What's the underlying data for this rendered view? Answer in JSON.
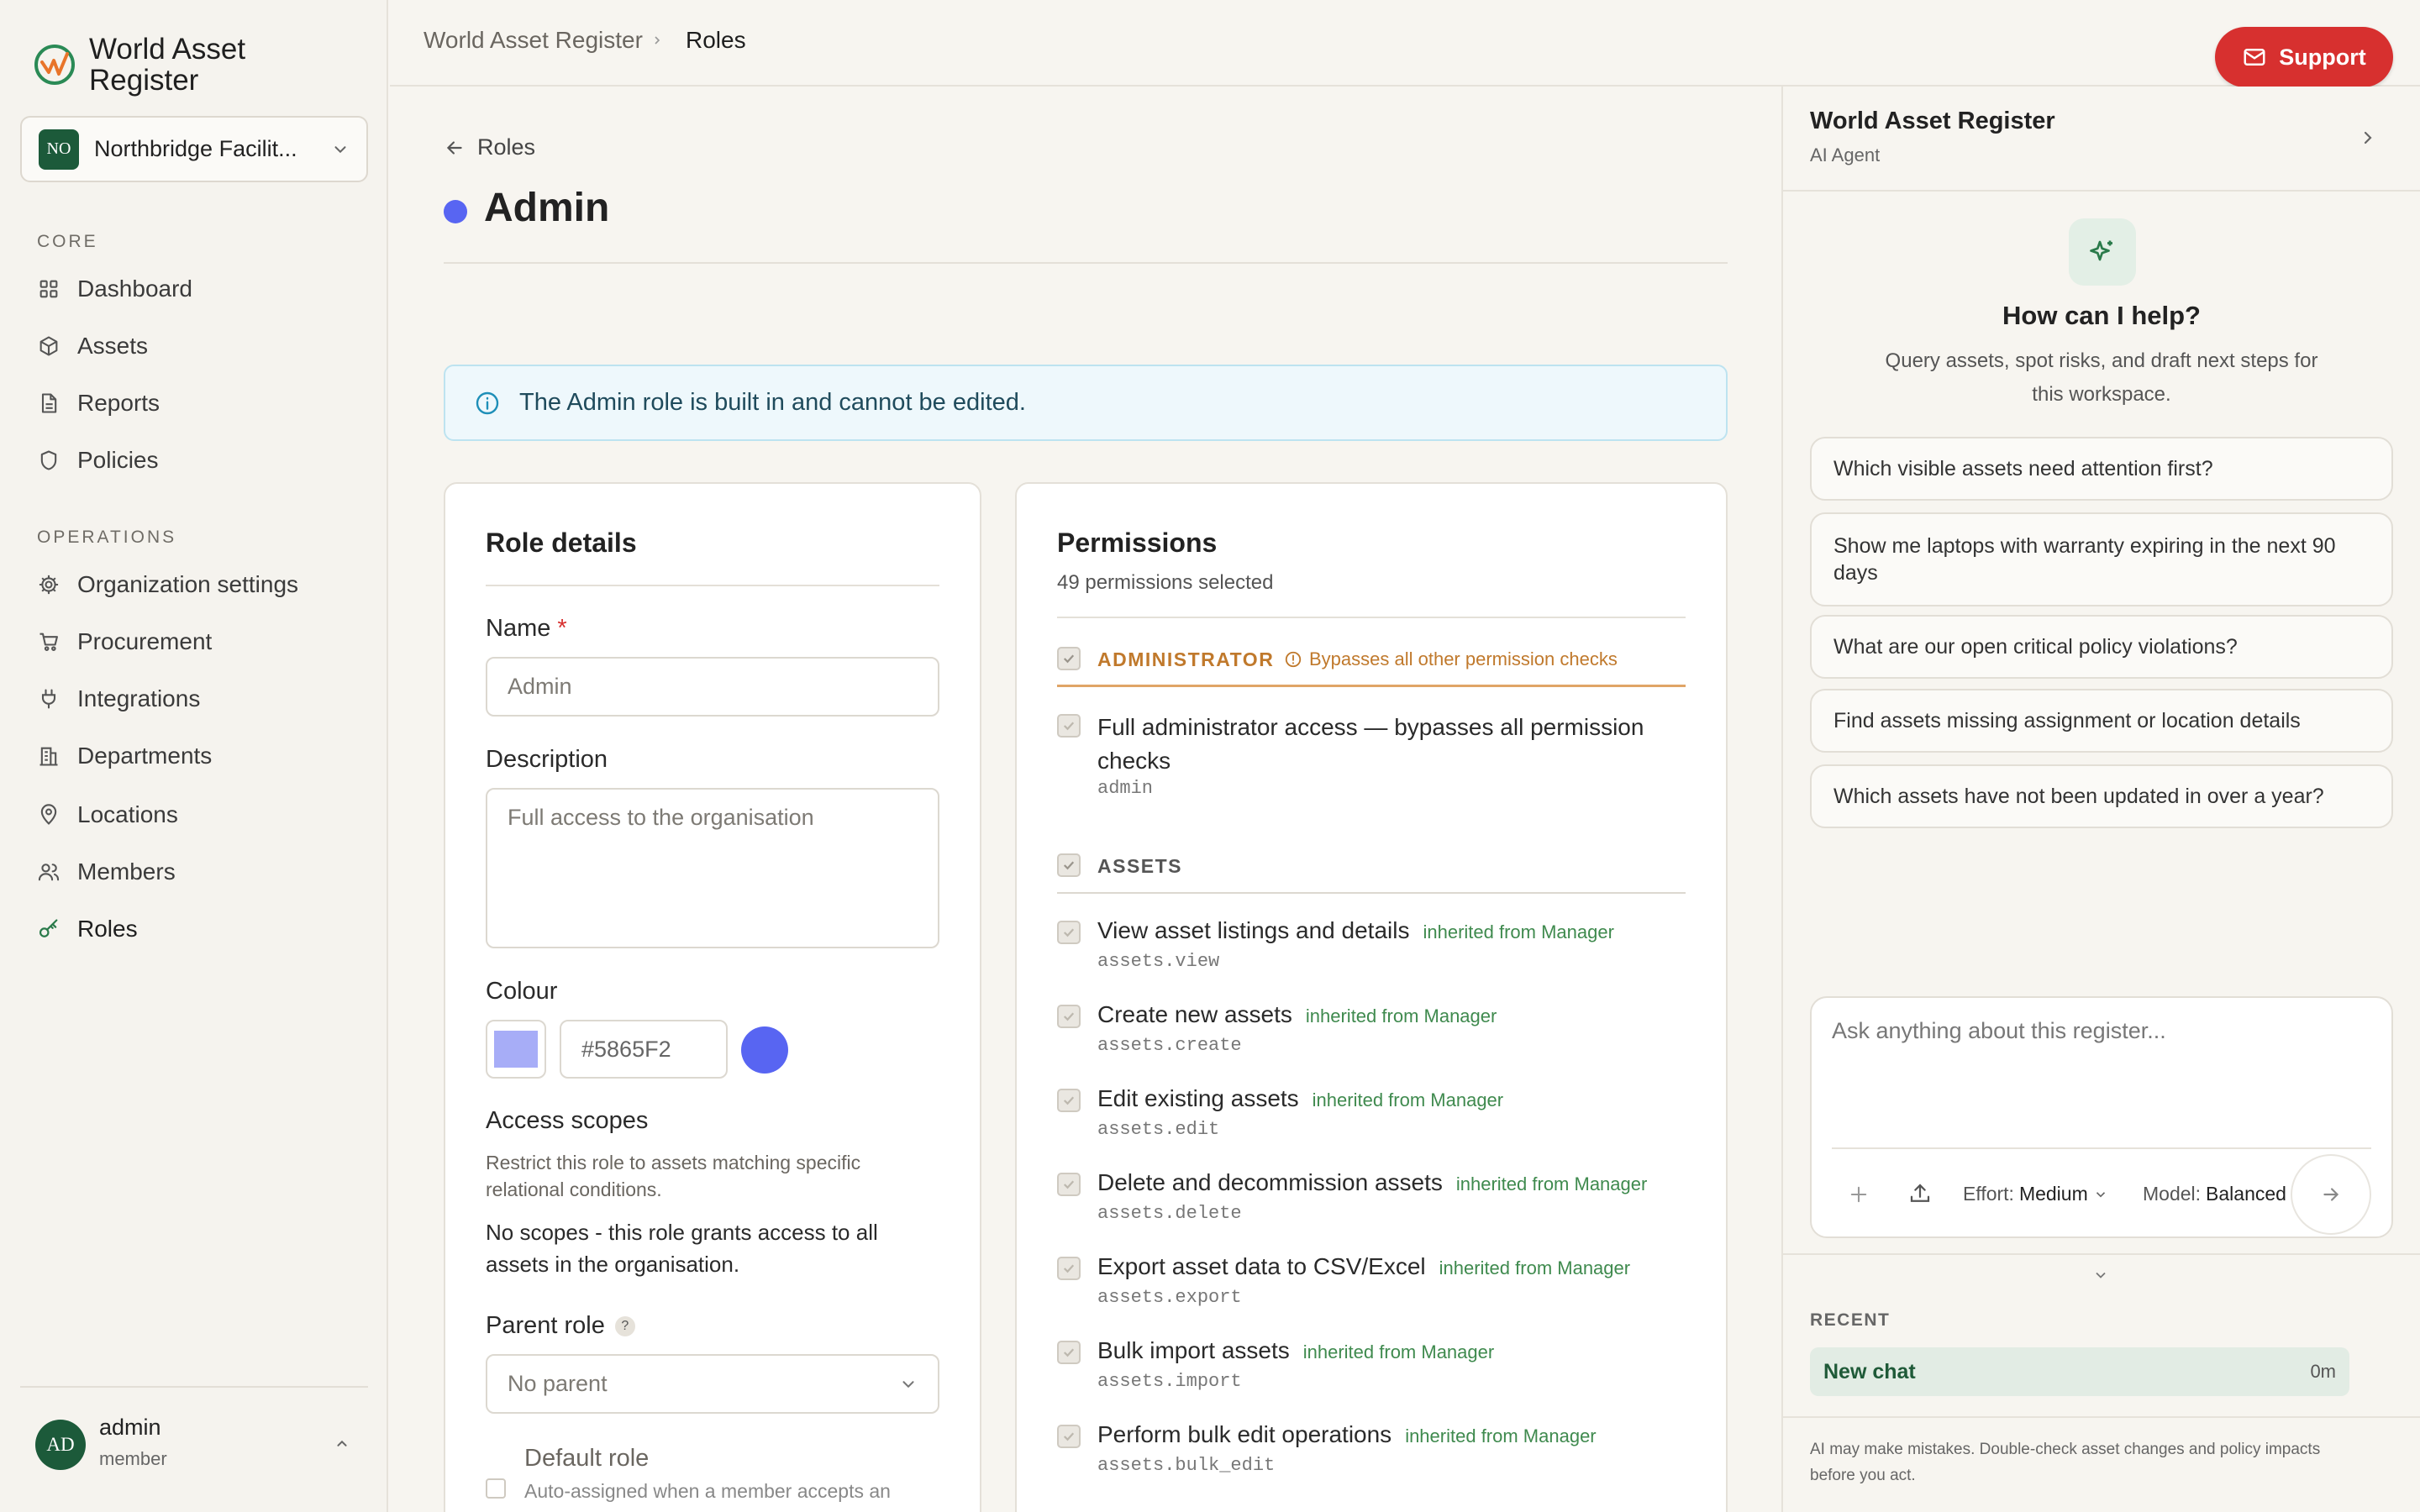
{
  "app": {
    "title": "World Asset Register"
  },
  "org": {
    "badge": "NO",
    "name": "Northbridge Facilit..."
  },
  "sidebar": {
    "core_heading": "CORE",
    "ops_heading": "OPERATIONS",
    "core_items": [
      {
        "label": "Dashboard",
        "icon": "grid-icon"
      },
      {
        "label": "Assets",
        "icon": "box-icon"
      },
      {
        "label": "Reports",
        "icon": "document-icon"
      },
      {
        "label": "Policies",
        "icon": "shield-icon"
      }
    ],
    "ops_items": [
      {
        "label": "Organization settings",
        "icon": "gear-icon"
      },
      {
        "label": "Procurement",
        "icon": "cart-icon"
      },
      {
        "label": "Integrations",
        "icon": "plug-icon"
      },
      {
        "label": "Departments",
        "icon": "building-icon"
      },
      {
        "label": "Locations",
        "icon": "pin-icon"
      },
      {
        "label": "Members",
        "icon": "users-icon"
      },
      {
        "label": "Roles",
        "icon": "key-icon",
        "active": true
      }
    ]
  },
  "user": {
    "initials": "AD",
    "name": "admin",
    "role": "member"
  },
  "breadcrumb": {
    "root": "World Asset Register",
    "current": "Roles"
  },
  "support": {
    "label": "Support"
  },
  "page": {
    "back_label": "Roles",
    "title": "Admin",
    "role_color": "#5865F2",
    "notice": "The Admin role is built in and cannot be edited."
  },
  "role_details": {
    "heading": "Role details",
    "name_label": "Name",
    "required_mark": "*",
    "name_placeholder": "Admin",
    "description_label": "Description",
    "description_placeholder": "Full access to the organisation",
    "colour_label": "Colour",
    "colour_value": "#5865F2",
    "access_scopes_label": "Access scopes",
    "access_scopes_hint": "Restrict this role to assets matching specific relational conditions.",
    "access_scopes_text": "No scopes - this role grants access to all assets in the organisation.",
    "parent_role_label": "Parent role",
    "parent_role_help": "?",
    "parent_role_value": "No parent",
    "default_role_label": "Default role",
    "default_role_hint": "Auto-assigned when a member accepts an"
  },
  "permissions": {
    "heading": "Permissions",
    "count_text": "49 permissions selected",
    "admin_group": {
      "label": "ADMINISTRATOR",
      "note": "Bypasses all other permission checks",
      "item_label_1": "Full administrator access — bypasses all permission",
      "item_label_2": "checks",
      "item_code": "admin"
    },
    "assets_group": {
      "label": "ASSETS"
    },
    "items": [
      {
        "label": "View asset listings and details",
        "inherited": "inherited from Manager",
        "code": "assets.view"
      },
      {
        "label": "Create new assets",
        "inherited": "inherited from Manager",
        "code": "assets.create"
      },
      {
        "label": "Edit existing assets",
        "inherited": "inherited from Manager",
        "code": "assets.edit"
      },
      {
        "label": "Delete and decommission assets",
        "inherited": "inherited from Manager",
        "code": "assets.delete"
      },
      {
        "label": "Export asset data to CSV/Excel",
        "inherited": "inherited from Manager",
        "code": "assets.export"
      },
      {
        "label": "Bulk import assets",
        "inherited": "inherited from Manager",
        "code": "assets.import"
      },
      {
        "label": "Perform bulk edit operations",
        "inherited": "inherited from Manager",
        "code": "assets.bulk_edit"
      }
    ]
  },
  "agent": {
    "title": "World Asset Register",
    "subtitle": "AI Agent",
    "help_title": "How can I help?",
    "help_text_1": "Query assets, spot risks, and draft next steps for",
    "help_text_2": "this workspace.",
    "suggestions": [
      "Which visible assets need attention first?",
      "Show me laptops with warranty expiring in the next 90 days",
      "What are our open critical policy violations?",
      "Find assets missing assignment or location details",
      "Which assets have not been updated in over a year?"
    ],
    "input_placeholder": "Ask anything about this register...",
    "effort_label": "Effort:",
    "effort_value": "Medium",
    "model_label": "Model:",
    "model_value": "Balanced",
    "recent_heading": "RECENT",
    "recent_items": [
      {
        "title": "New chat",
        "age": "0m"
      }
    ],
    "disclaimer_1": "AI may make mistakes. Double-check asset changes and policy impacts",
    "disclaimer_2": "before you act."
  },
  "colors": {
    "accent_red": "#D7302F",
    "brand_green": "#1C5A3A",
    "role_blue": "#5865F2"
  }
}
